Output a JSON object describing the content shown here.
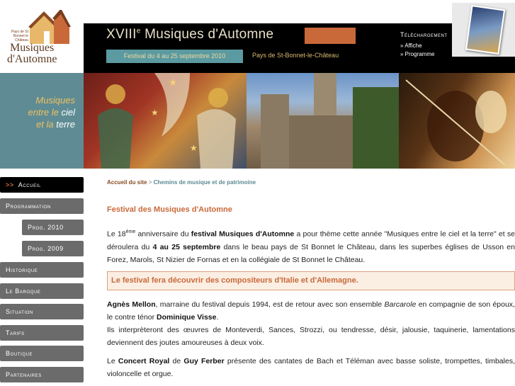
{
  "logo": {
    "small_text": "Pays de St Bonnet le Château",
    "line1": "Musiques",
    "line2": "d'Automne"
  },
  "header": {
    "title_prefix": "XVIII",
    "title_sup": "e",
    "title_main": "Musiques d'Automne",
    "dates": "Festival du 4 au 25 septembre 2010",
    "place": "Pays de St-Bonnet-le-Château",
    "download_title": "Téléchargement",
    "download_links": [
      "» Affiche",
      "» Programme"
    ]
  },
  "tagline": {
    "line1": "Musiques",
    "line2_a": "entre le ",
    "line2_b": "ciel",
    "line3_a": "et la ",
    "line3_b": "terre"
  },
  "nav": {
    "active_marker": ">>",
    "items": [
      "Accueil",
      "Programmation",
      "Prog. 2010",
      "Prog. 2009",
      "Historique",
      "Le Baroque",
      "Situation",
      "Tarifs",
      "Boutique",
      "Partenaires"
    ]
  },
  "breadcrumb": {
    "home": "Accueil du site",
    "sep": " > ",
    "current": "Chemins de musique et de patrimoine"
  },
  "content": {
    "title": "Festival des Musiques d'Automne",
    "p1_a": "Le 18",
    "p1_sup": "ème",
    "p1_b": " anniversaire du ",
    "p1_bold1": "festival Musiques d'Automne",
    "p1_c": " a pour thème cette année \"Musiques entre le ciel et la terre\" et se déroulera du ",
    "p1_bold2": "4 au 25 septembre",
    "p1_d": " dans le beau pays de St Bonnet le Château, dans les superbes églises de Usson en Forez, Marols, St Nizier de Fornas et en la collégiale de St Bonnet le Château.",
    "highlight": "Le festival fera découvrir des compositeurs d'Italie et d'Allemagne.",
    "p2_bold1": "Agnès Mellon",
    "p2_a": ", marraine du festival depuis 1994, est de retour avec son ensemble ",
    "p2_italic": "Barcarole",
    "p2_b": " en compagnie de son époux, le contre ténor ",
    "p2_bold2": "Dominique Visse",
    "p2_c": ".",
    "p3": "Ils interprèteront des œuvres de Monteverdi, Sances, Strozzi, ou tendresse, désir, jalousie, taquinerie, lamentations deviennent des joutes amoureuses à deux voix.",
    "p4_a": "Le ",
    "p4_bold1": "Concert Royal",
    "p4_b": " de ",
    "p4_bold2": "Guy Ferber",
    "p4_c": " présente des cantates de Bach et Téléman avec basse soliste, trompettes, timbales, violoncelle et orgue."
  },
  "colors": {
    "accent": "#c9693a",
    "teal": "#5f8c94",
    "nav_bg": "#6b6b6b"
  }
}
